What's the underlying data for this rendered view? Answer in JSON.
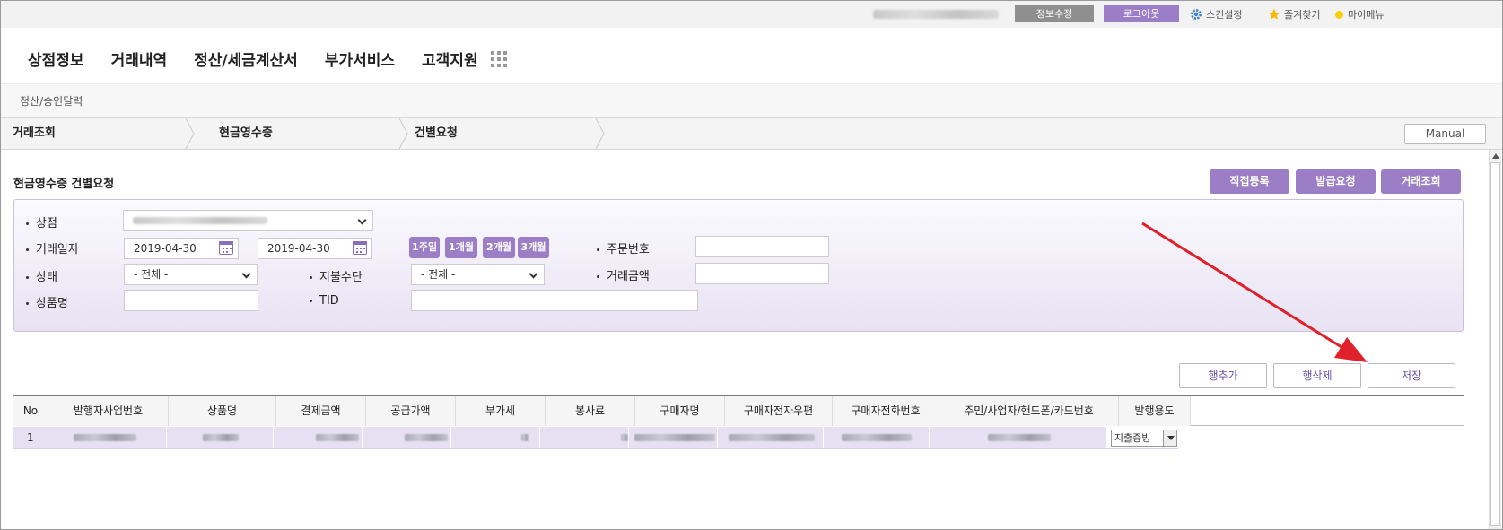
{
  "topbar": {
    "edit_info_label": "정보수정",
    "logout_label": "로그아웃",
    "skin_settings_label": "스킨설정",
    "favorites_label": "즐겨찾기",
    "my_menu_label": "마이메뉴",
    "edit_info_color": "#8f8f8f",
    "logout_color": "#9b7ec5"
  },
  "nav": {
    "items": [
      "상점정보",
      "거래내역",
      "정산/세금계산서",
      "부가서비스",
      "고객지원"
    ]
  },
  "subnav": {
    "current": "정산/승인달력"
  },
  "breadcrumb": {
    "items": [
      "거래조회",
      "현금영수증",
      "건별요청"
    ],
    "manual_label": "Manual"
  },
  "page": {
    "title": "현금영수증 건별요청",
    "actions": [
      "직접등록",
      "발급요청",
      "거래조회"
    ]
  },
  "search": {
    "store_label": "상점",
    "date_label": "거래일자",
    "date_from": "2019-04-30",
    "date_to": "2019-04-30",
    "date_separator": "-",
    "periods": [
      "1주일",
      "1개월",
      "2개월",
      "3개월"
    ],
    "order_no_label": "주문번호",
    "status_label": "상태",
    "status_value": "- 전체 -",
    "payment_label": "지불수단",
    "payment_value": "- 전체 -",
    "amount_label": "거래금액",
    "product_label": "상품명",
    "tid_label": "TID"
  },
  "row_actions": [
    "행추가",
    "행삭제",
    "저장"
  ],
  "table": {
    "headers": [
      "No",
      "발행자사업번호",
      "상품명",
      "결제금액",
      "공급가액",
      "부가세",
      "봉사료",
      "구매자명",
      "구매자전자우편",
      "구매자전화번호",
      "주민/사업자/핸드폰/카드번호",
      "발행용도"
    ],
    "rows": [
      {
        "no": "1",
        "usage": "지출증빙"
      }
    ]
  },
  "annotation": {
    "arrow_color": "#e0202a"
  }
}
